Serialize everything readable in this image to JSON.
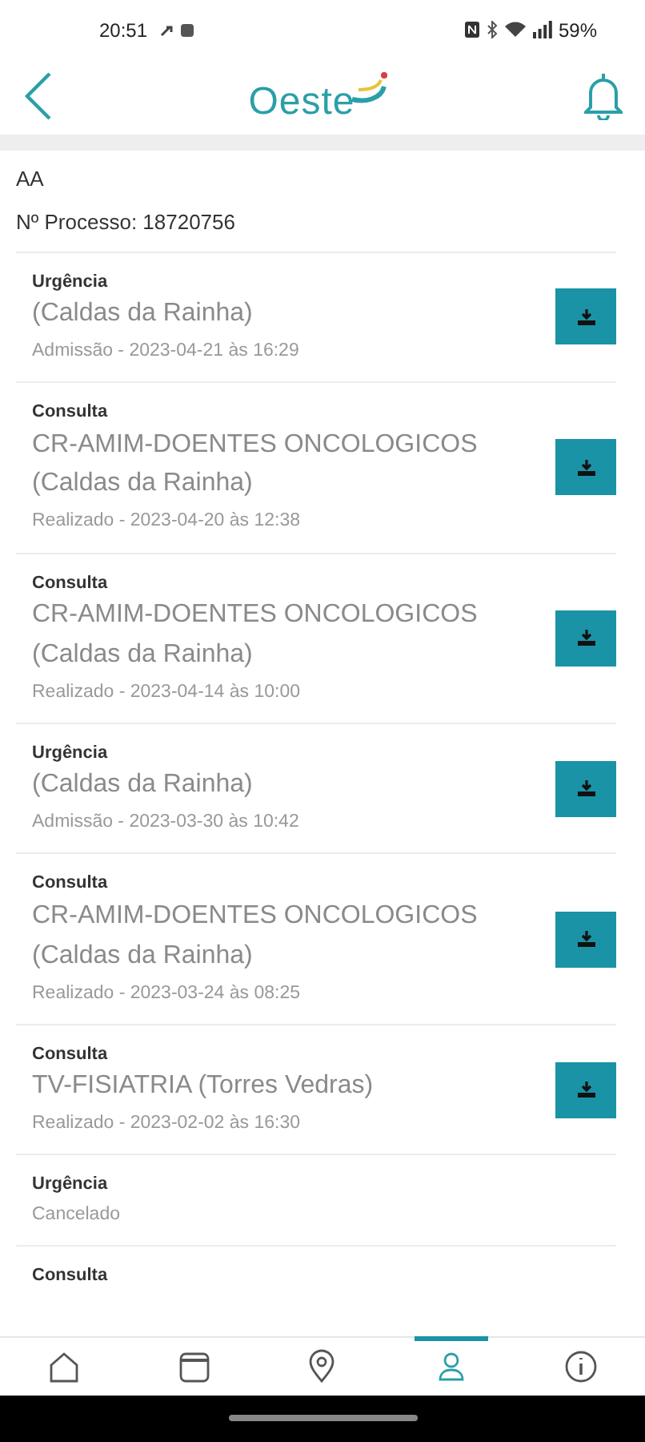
{
  "status_bar": {
    "time": "20:51",
    "battery": "59%"
  },
  "header": {
    "logo_text": "Oeste"
  },
  "patient": {
    "name": "AA",
    "process": "Nº Processo: 18720756"
  },
  "episodes": [
    {
      "type": "Urgência",
      "title": "(Caldas da Rainha)",
      "detail": "Admissão - 2023-04-21 às 16:29",
      "download": true
    },
    {
      "type": "Consulta",
      "title": "CR-AMIM-DOENTES ONCOLOGICOS (Caldas da Rainha)",
      "detail": "Realizado - 2023-04-20 às 12:38",
      "download": true
    },
    {
      "type": "Consulta",
      "title": "CR-AMIM-DOENTES ONCOLOGICOS (Caldas da Rainha)",
      "detail": "Realizado - 2023-04-14 às 10:00",
      "download": true
    },
    {
      "type": "Urgência",
      "title": "(Caldas da Rainha)",
      "detail": "Admissão - 2023-03-30 às 10:42",
      "download": true
    },
    {
      "type": "Consulta",
      "title": "CR-AMIM-DOENTES ONCOLOGICOS (Caldas da Rainha)",
      "detail": "Realizado - 2023-03-24 às 08:25",
      "download": true
    },
    {
      "type": "Consulta",
      "title": "TV-FISIATRIA (Torres Vedras)",
      "detail": "Realizado - 2023-02-02 às 16:30",
      "download": true
    },
    {
      "type": "Urgência",
      "detail": "Cancelado",
      "download": false
    },
    {
      "type": "Consulta"
    }
  ],
  "tabs": [
    {
      "selected": false
    },
    {
      "selected": false
    },
    {
      "selected": false
    },
    {
      "selected": true
    },
    {
      "selected": false
    }
  ]
}
